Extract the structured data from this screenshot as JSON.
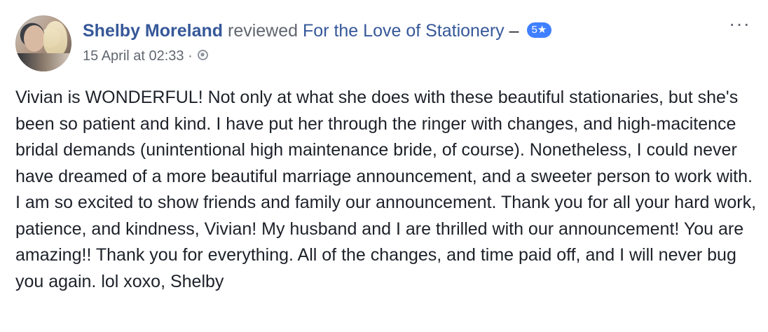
{
  "post": {
    "author": "Shelby Moreland",
    "verb": "reviewed",
    "page": "For the Love of Stationery",
    "separator": "–",
    "rating": "5★",
    "timestamp": "15 April at 02:33",
    "dot": "·",
    "privacy_icon": "globe-icon",
    "more_icon": "more-options-icon",
    "more_glyph": "···",
    "body": "Vivian is WONDERFUL! Not only at what she does with these beautiful stationaries, but she's been so patient and kind. I have put her through the ringer with changes, and high-macitence bridal demands (unintentional high maintenance bride, of course). Nonetheless, I could never have dreamed of a more beautiful marriage announcement, and a sweeter person to work with. I am so excited to show friends and family our announcement. Thank you for all your hard work, patience, and kindness, Vivian! My husband and I are thrilled with our announcement! You are amazing!! Thank you for everything. All of the changes, and time paid off, and I will never bug you again. lol xoxo, Shelby"
  },
  "colors": {
    "link": "#365899",
    "meta": "#616770",
    "badge": "#4080ff",
    "text": "#1d2129"
  }
}
